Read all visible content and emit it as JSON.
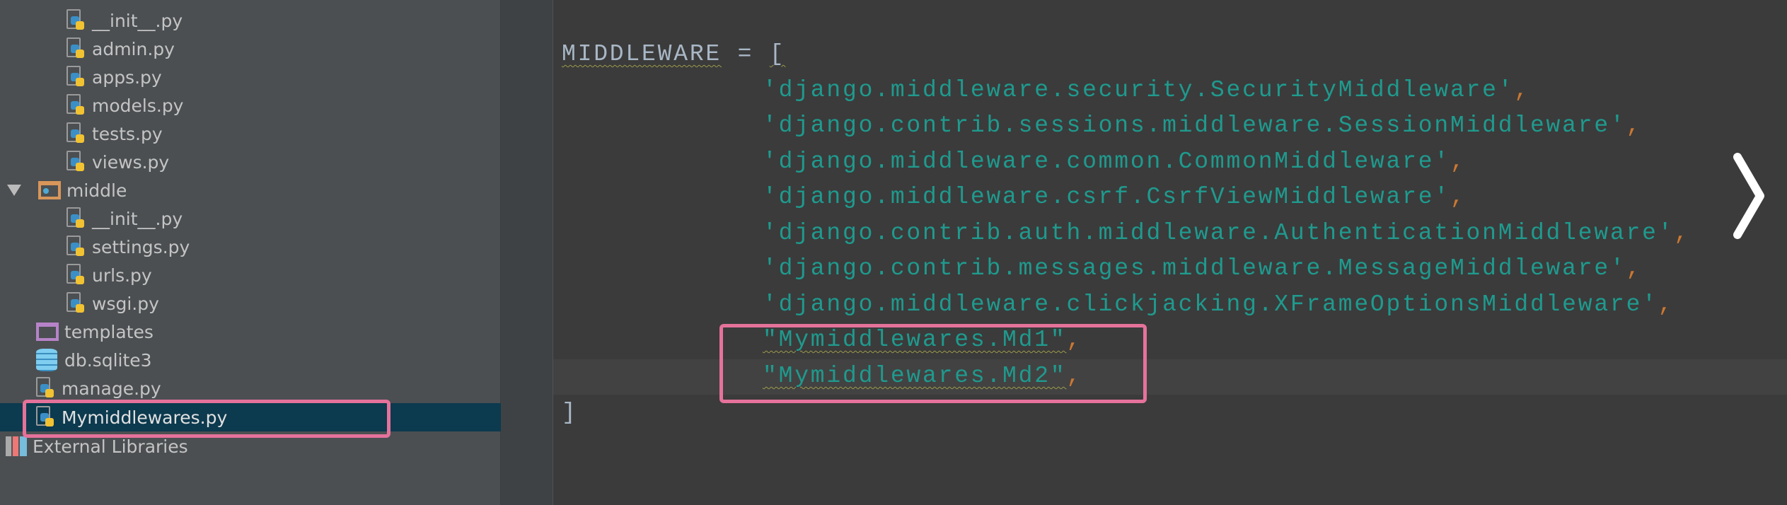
{
  "project_tree": {
    "items": [
      {
        "label": "__init__.py",
        "type": "python-file"
      },
      {
        "label": "admin.py",
        "type": "python-file"
      },
      {
        "label": "apps.py",
        "type": "python-file"
      },
      {
        "label": "models.py",
        "type": "python-file"
      },
      {
        "label": "tests.py",
        "type": "python-file"
      },
      {
        "label": "views.py",
        "type": "python-file"
      },
      {
        "label": "middle",
        "type": "package-folder",
        "expanded": true
      },
      {
        "label": "__init__.py",
        "type": "python-file"
      },
      {
        "label": "settings.py",
        "type": "python-file"
      },
      {
        "label": "urls.py",
        "type": "python-file"
      },
      {
        "label": "wsgi.py",
        "type": "python-file"
      },
      {
        "label": "templates",
        "type": "templates-folder"
      },
      {
        "label": "db.sqlite3",
        "type": "database-file"
      },
      {
        "label": "manage.py",
        "type": "python-file"
      },
      {
        "label": "Mymiddlewares.py",
        "type": "python-file",
        "selected": true
      },
      {
        "label": "External Libraries",
        "type": "libraries"
      }
    ]
  },
  "editor": {
    "line0": {
      "ident": "MIDDLEWARE",
      "op": " = ",
      "bracket": "["
    },
    "strings": [
      "'django.middleware.security.SecurityMiddleware'",
      "'django.contrib.sessions.middleware.SessionMiddleware'",
      "'django.middleware.common.CommonMiddleware'",
      "'django.middleware.csrf.CsrfViewMiddleware'",
      "'django.contrib.auth.middleware.AuthenticationMiddleware'",
      "'django.contrib.messages.middleware.MessageMiddleware'",
      "'django.middleware.clickjacking.XFrameOptionsMiddleware'",
      "\"Mymiddlewares.Md1\"",
      "\"Mymiddlewares.Md2\""
    ],
    "comma": ",",
    "closing": "]"
  },
  "colors": {
    "highlight_box": "#e5729a",
    "string": "#1f9a8e",
    "selection": "#0c3a4f",
    "comma": "#cc7832"
  }
}
